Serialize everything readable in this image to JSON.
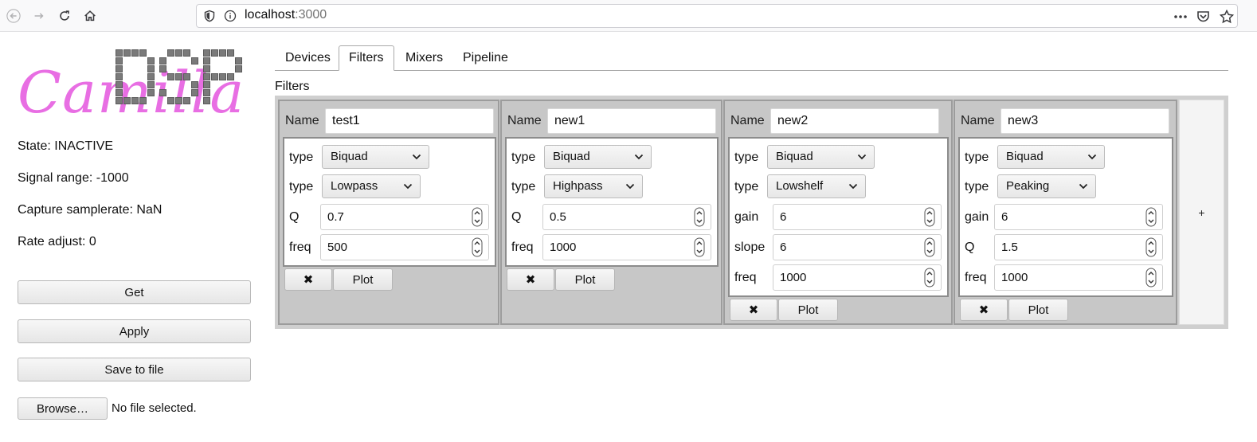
{
  "browser": {
    "url_host": "localhost",
    "url_port": ":3000",
    "icons": [
      "back-icon",
      "forward-icon",
      "reload-icon",
      "home-icon",
      "shield-icon",
      "info-icon",
      "more-icon",
      "pocket-icon",
      "bookmark-star-icon"
    ]
  },
  "logo": {
    "word": "Camilla",
    "dsp_letters": [
      "D",
      "S",
      "P"
    ]
  },
  "status": {
    "state": "State: INACTIVE",
    "signal_range": "Signal range: -1000",
    "capture_samplerate": "Capture samplerate: NaN",
    "rate_adjust": "Rate adjust: 0"
  },
  "actions": {
    "get": "Get",
    "apply": "Apply",
    "save": "Save to file",
    "browse": "Browse…",
    "file_status": "No file selected."
  },
  "tabs": [
    {
      "label": "Devices",
      "active": false
    },
    {
      "label": "Filters",
      "active": true
    },
    {
      "label": "Mixers",
      "active": false
    },
    {
      "label": "Pipeline",
      "active": false
    }
  ],
  "section_title": "Filters",
  "filters": [
    {
      "name_label": "Name",
      "name": "test1",
      "type_label": "type",
      "type": "Biquad",
      "subtype_label": "type",
      "subtype": "Lowpass",
      "params": [
        {
          "label": "Q",
          "value": "0.7"
        },
        {
          "label": "freq",
          "value": "500"
        }
      ],
      "delete_label": "✖",
      "plot_label": "Plot"
    },
    {
      "name_label": "Name",
      "name": "new1",
      "type_label": "type",
      "type": "Biquad",
      "subtype_label": "type",
      "subtype": "Highpass",
      "params": [
        {
          "label": "Q",
          "value": "0.5"
        },
        {
          "label": "freq",
          "value": "1000"
        }
      ],
      "delete_label": "✖",
      "plot_label": "Plot"
    },
    {
      "name_label": "Name",
      "name": "new2",
      "type_label": "type",
      "type": "Biquad",
      "subtype_label": "type",
      "subtype": "Lowshelf",
      "params": [
        {
          "label": "gain",
          "value": "6"
        },
        {
          "label": "slope",
          "value": "6"
        },
        {
          "label": "freq",
          "value": "1000"
        }
      ],
      "delete_label": "✖",
      "plot_label": "Plot"
    },
    {
      "name_label": "Name",
      "name": "new3",
      "type_label": "type",
      "type": "Biquad",
      "subtype_label": "type",
      "subtype": "Peaking",
      "params": [
        {
          "label": "gain",
          "value": "6"
        },
        {
          "label": "Q",
          "value": "1.5"
        },
        {
          "label": "freq",
          "value": "1000"
        }
      ],
      "delete_label": "✖",
      "plot_label": "Plot"
    }
  ],
  "add_filter_label": "+"
}
